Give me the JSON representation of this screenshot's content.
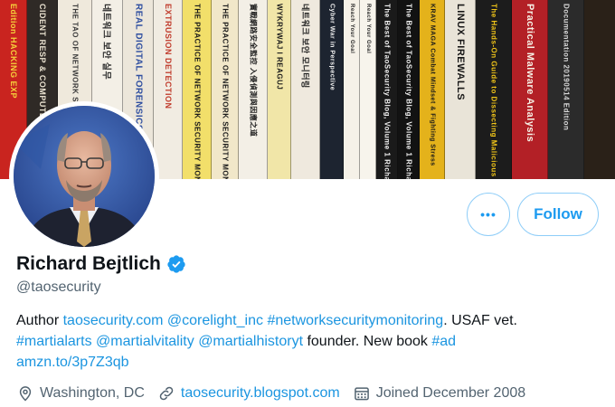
{
  "banner": {
    "books": [
      {
        "title": "Edition",
        "subtitle": "HACKING EXP",
        "bg": "#c9241f",
        "fg": "#f5d23b"
      },
      {
        "title": "CIDENT RESP",
        "subtitle": "& COMPUTER",
        "bg": "#2f2a26",
        "fg": "#e9e1cf"
      },
      {
        "title": "THE TAO OF NETWORK SECURITY MONITORING",
        "subtitle": "",
        "bg": "#efe9dc",
        "fg": "#3a3a3a"
      },
      {
        "title": "네트워크 보안 실무",
        "subtitle": "",
        "bg": "#f3efe6",
        "fg": "#2a2a2a"
      },
      {
        "title": "REAL DIGITAL FORENSICS",
        "subtitle": "",
        "bg": "#ece6da",
        "fg": "#2f4fa0"
      },
      {
        "title": "EXTRUSION DETECTION",
        "subtitle": "",
        "bg": "#f1ece2",
        "fg": "#c03a2b"
      },
      {
        "title": "THE PRACTICE OF NETWORK SECURITY MONITORING",
        "subtitle": "",
        "bg": "#f2df6a",
        "fg": "#1a1a1a"
      },
      {
        "title": "THE PRACTICE OF NETWORK SECURITY MONITORING",
        "subtitle": "",
        "bg": "#f1e7c9",
        "fg": "#1a1a1a"
      },
      {
        "title": "實戰網路安全監控 入侵偵測與因應之道",
        "subtitle": "",
        "bg": "#f3efe6",
        "fg": "#222"
      },
      {
        "title": "WYKRYWAJ I REAGUJ",
        "subtitle": "",
        "bg": "#f1e6a8",
        "fg": "#1a1a1a"
      },
      {
        "title": "네트워크 보안 모니터링",
        "subtitle": "",
        "bg": "#efe9de",
        "fg": "#222"
      },
      {
        "title": "Cyber War in Perspective",
        "subtitle": "",
        "bg": "#1d2430",
        "fg": "#f0f0f0"
      },
      {
        "title": "Reach Your Goal",
        "subtitle": "",
        "bg": "#f5f1e8",
        "fg": "#2a2a2a"
      },
      {
        "title": "Reach Your Goal",
        "subtitle": "",
        "bg": "#f7f4ec",
        "fg": "#2a2a2a"
      },
      {
        "title": "The Best of TaoSecurity Blog, Volume 1",
        "subtitle": "Richard",
        "bg": "#1a1a1a",
        "fg": "#f0f0f0"
      },
      {
        "title": "The Best of TaoSecurity Blog, Volume 1",
        "subtitle": "Richard",
        "bg": "#121212",
        "fg": "#f0f0f0"
      },
      {
        "title": "KRAV MAGA Combat Mindset & Fighting Stress",
        "subtitle": "",
        "bg": "#e4b21b",
        "fg": "#1a1a1a"
      },
      {
        "title": "LINUX FIREWALLS",
        "subtitle": "",
        "bg": "#e9e4d8",
        "fg": "#151515"
      },
      {
        "title": "The Hands-On Guide to Dissecting Malicious Software",
        "subtitle": "",
        "bg": "#1c1c1c",
        "fg": "#f0c419"
      },
      {
        "title": "Practical Malware Analysis",
        "subtitle": "",
        "bg": "#b32026",
        "fg": "#f6f1e6"
      },
      {
        "title": "Documentation 20190514 Edition",
        "subtitle": "",
        "bg": "#2b2b2b",
        "fg": "#d9d9d9"
      }
    ]
  },
  "profile": {
    "display_name": "Richard Bejtlich",
    "handle": "@taosecurity",
    "verified_icon": "verified-badge-icon"
  },
  "actions": {
    "more_label": "•••",
    "follow_label": "Follow"
  },
  "bio": {
    "line1": [
      {
        "text": "Author ",
        "link": false
      },
      {
        "text": "taosecurity.com",
        "link": true
      },
      {
        "text": " ",
        "link": false
      },
      {
        "text": "@corelight_inc",
        "link": true
      },
      {
        "text": " ",
        "link": false
      },
      {
        "text": "#networksecuritymonitoring",
        "link": true
      },
      {
        "text": ". USAF vet.",
        "link": false
      }
    ],
    "line2": [
      {
        "text": "#martialarts",
        "link": true
      },
      {
        "text": " ",
        "link": false
      },
      {
        "text": "@martialvitality",
        "link": true
      },
      {
        "text": " ",
        "link": false
      },
      {
        "text": "@martialhistoryt",
        "link": true
      },
      {
        "text": " founder. New book ",
        "link": false
      },
      {
        "text": "#ad",
        "link": true
      }
    ],
    "line3": [
      {
        "text": "amzn.to/3p7Z3qb",
        "link": true
      }
    ]
  },
  "meta": {
    "location": "Washington, DC",
    "location_icon": "location-pin-icon",
    "website": "taosecurity.blogspot.com",
    "website_icon": "link-icon",
    "joined": "Joined December 2008",
    "joined_icon": "calendar-icon"
  },
  "colors": {
    "accent": "#1d9bf0",
    "link": "#1b95e0",
    "secondary_text": "#536471",
    "primary_text": "#0f1419"
  }
}
